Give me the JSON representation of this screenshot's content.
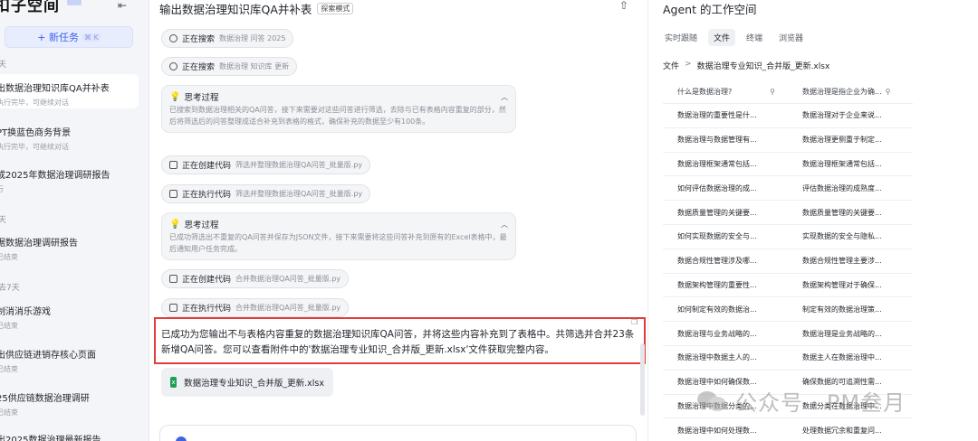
{
  "sidebar": {
    "logo": "扣子空间",
    "collapse_icon": "collapse-sidebar-icon",
    "new_task_label": "+ 新任务",
    "new_task_shortcut": "⌘ K",
    "groups": [
      {
        "label": "天"
      },
      {
        "label": "天"
      },
      {
        "label": "去7天"
      }
    ],
    "tasks": [
      {
        "title": "出数据治理知识库QA并补表",
        "sub": "执行完毕，可继续对话"
      },
      {
        "title": "PT换蓝色商务背景",
        "sub": "执行完毕，可继续对话"
      },
      {
        "title": "成2025年数据治理调研报告",
        "sub": "行"
      },
      {
        "title": "据数据治理调研报告",
        "sub": "已结束"
      },
      {
        "title": "制消消乐游戏",
        "sub": "已结束"
      },
      {
        "title": "出供应链进销存核心页面",
        "sub": "已结束"
      },
      {
        "title": "25供应链数据治理调研",
        "sub": "已结束"
      },
      {
        "title": "出2025数据治理最新报告",
        "sub": ""
      }
    ]
  },
  "main": {
    "title": "输出数据治理知识库QA并补表",
    "mode_badge": "探索模式",
    "steps": [
      {
        "status": "正在搜索",
        "detail": "数据治理 问答 2025"
      },
      {
        "status": "正在搜索",
        "detail": "数据治理 知识库 更新"
      },
      {
        "status": "正在创建代码",
        "detail": "筛选并整理数据治理QA问答_批量版.py"
      },
      {
        "status": "正在执行代码",
        "detail": "筛选并整理数据治理QA问答_批量版.py"
      },
      {
        "status": "正在创建代码",
        "detail": "合并数据治理QA问答_批量版.py"
      },
      {
        "status": "正在执行代码",
        "detail": "合并数据治理QA问答_批量版.py"
      }
    ],
    "thinking": [
      {
        "title": "思考过程",
        "body": "已搜索到数据治理相关的QA问答，接下来需要对这些问答进行筛选，去除与已有表格内容重复的部分，然后将筛选后的问答整理成适合补充到表格的格式，确保补充的数据至少有100条。"
      },
      {
        "title": "思考过程",
        "body": "已成功筛选出不重复的QA问答并保存为JSON文件，接下来需要将这些问答补充到原有的Excel表格中，最后通知用户任务完成。"
      }
    ],
    "answer": "已成功为您输出不与表格内容重复的数据治理知识库QA问答，并将这些内容补充到了表格中。共筛选并合并23条新增QA问答。您可以查看附件中的'数据治理专业知识_合并版_更新.xlsx'文件获取完整内容。",
    "file_name": "数据治理专业知识_合并版_更新.xlsx"
  },
  "workspace": {
    "title": "Agent 的工作空间",
    "tabs": [
      "实时跟随",
      "文件",
      "终端",
      "浏览器"
    ],
    "active_tab": "文件",
    "breadcrumb_root": "文件",
    "breadcrumb_sep": ">",
    "breadcrumb_file": "数据治理专业知识_合并版_更新.xlsx",
    "columns": [
      "什么是数据治理?",
      "数据治理是指企业为确..."
    ],
    "rows": [
      [
        "数据治理的重要性是什...",
        "数据治理对于企业来说..."
      ],
      [
        "数据治理与数据管理有...",
        "数据治理更侧重于制定..."
      ],
      [
        "数据治理框架通常包括...",
        "数据治理框架通常包括..."
      ],
      [
        "如何评估数据治理的成...",
        "评估数据治理的成熟度..."
      ],
      [
        "数据质量管理的关键要...",
        "数据质量管理的关键要..."
      ],
      [
        "如何实现数据的安全与...",
        "实现数据的安全与隐私..."
      ],
      [
        "数据合规性管理涉及哪...",
        "数据合规性管理主要涉..."
      ],
      [
        "数据架构管理的重要性...",
        "数据架构管理对于确保..."
      ],
      [
        "如何制定有效的数据治...",
        "制定有效的数据治理策..."
      ],
      [
        "数据治理与业务战略的...",
        "数据治理是业务战略的..."
      ],
      [
        "数据治理中数据主人的...",
        "数据主人在数据治理中..."
      ],
      [
        "数据治理中如何确保数...",
        "确保数据的可追溯性需..."
      ],
      [
        "数据治理中数据分类的...",
        "数据分类在数据治理中..."
      ],
      [
        "数据治理中如何处理数...",
        "处理数据冗余和重复问..."
      ]
    ]
  },
  "watermark": {
    "text": "公众号 · PM叁月",
    "logo": "wechat-logo"
  }
}
